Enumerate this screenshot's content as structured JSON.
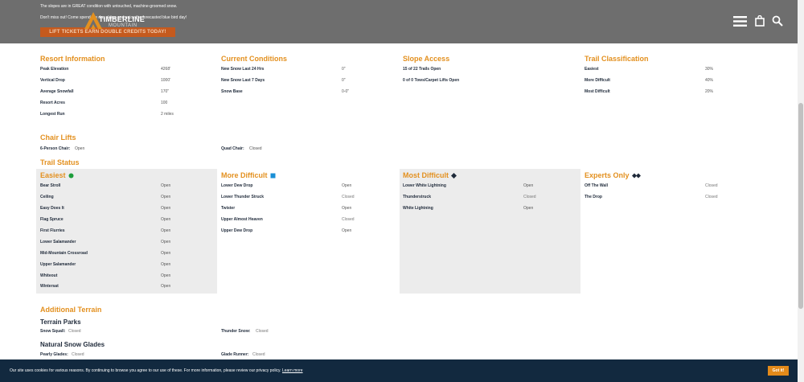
{
  "header": {
    "promo_line1": "The slopes are in GREAT condition with untouched, machine-groomed snow.",
    "promo_line2": "Don't miss out! Come spend the day skiing and enjoy the forecasted blue bird day!",
    "promo_button": "LIFT TICKETS EARN DOUBLE CREDITS TODAY!",
    "logo_name": "TIMBERLINE",
    "logo_sub": "MOUNTAIN",
    "icons": [
      "menu-icon",
      "shopping-bag-icon",
      "search-icon"
    ],
    "background": "#6e6e6e"
  },
  "resort_information": {
    "title": "Resort Information",
    "rows": [
      {
        "label": "Peak Elevation",
        "value": "4268'"
      },
      {
        "label": "Vertical Drop",
        "value": "1000'"
      },
      {
        "label": "Average Snowfall",
        "value": "170\""
      },
      {
        "label": "Resort Acres",
        "value": "100"
      },
      {
        "label": "Longest Run",
        "value": "2 miles"
      }
    ]
  },
  "current_conditions": {
    "title": "Current Conditions",
    "rows": [
      {
        "label": "New Snow Last 24 Hrs",
        "value": "0\""
      },
      {
        "label": "New Snow Last 7 Days",
        "value": "0\""
      },
      {
        "label": "Snow Base",
        "value": "0-0\""
      }
    ]
  },
  "slope_access": {
    "title": "Slope Access",
    "rows": [
      {
        "label": "15 of 22 Trails Open"
      },
      {
        "label": "0 of 0 Tows/Carpet Lifts Open"
      }
    ]
  },
  "trail_classification": {
    "title": "Trail Classification",
    "rows": [
      {
        "label": "Easiest",
        "value": "30%"
      },
      {
        "label": "More Difficult",
        "value": "40%"
      },
      {
        "label": "Most Difficult",
        "value": "20%"
      }
    ]
  },
  "chair_lifts": {
    "title": "Chair Lifts",
    "items": [
      {
        "label": "6-Person Chair:",
        "value": "Open"
      },
      {
        "label": "Quad Chair:",
        "value": "Closed"
      }
    ]
  },
  "trail_status": {
    "title": "Trail Status",
    "columns": [
      {
        "name": "Easiest",
        "icon": "green-circle-icon",
        "icon_color": "#1e9e3c",
        "shaded": true,
        "trails": [
          {
            "name": "Bear Stroll",
            "status": "Open"
          },
          {
            "name": "Ceiling",
            "status": "Open"
          },
          {
            "name": "Easy Does It",
            "status": "Open"
          },
          {
            "name": "Flag Spruce",
            "status": "Open"
          },
          {
            "name": "First Flurries",
            "status": "Open"
          },
          {
            "name": "Lower Salamander",
            "status": "Open"
          },
          {
            "name": "Mid-Mountain Crossroad",
            "status": "Open"
          },
          {
            "name": "Upper Salamander",
            "status": "Open"
          },
          {
            "name": "Whiteout",
            "status": "Open"
          },
          {
            "name": "Wintersat",
            "status": "Open"
          }
        ]
      },
      {
        "name": "More Difficult",
        "icon": "blue-square-icon",
        "icon_color": "#1a8fd6",
        "shaded": false,
        "trails": [
          {
            "name": "Lower Dew Drop",
            "status": "Open"
          },
          {
            "name": "Lower Thunder Struck",
            "status": "Closed"
          },
          {
            "name": "Twister",
            "status": "Open"
          },
          {
            "name": "Upper Almost Heaven",
            "status": "Closed"
          },
          {
            "name": "Upper Dew Drop",
            "status": "Open"
          }
        ]
      },
      {
        "name": "Most Difficult",
        "icon": "black-diamond-icon",
        "icon_color": "#1f2a3a",
        "shaded": true,
        "trails": [
          {
            "name": "Lower White Lightning",
            "status": "Open"
          },
          {
            "name": "Thunderstruck",
            "status": "Closed"
          },
          {
            "name": "White Lightning",
            "status": "Open"
          }
        ]
      },
      {
        "name": "Experts Only",
        "icon": "double-black-diamond-icon",
        "icon_color": "#1f2a3a",
        "shaded": false,
        "trails": [
          {
            "name": "Off The Wall",
            "status": "Closed"
          },
          {
            "name": "The Drop",
            "status": "Closed"
          }
        ]
      }
    ]
  },
  "additional_terrain": {
    "title": "Additional Terrain",
    "terrain_parks": {
      "title": "Terrain Parks",
      "items": [
        {
          "label": "Snow Squall:",
          "value": "Closed"
        },
        {
          "label": "Thunder Snow:",
          "value": "Closed"
        }
      ]
    },
    "natural_snow_glades": {
      "title": "Natural Snow Glades",
      "items": [
        {
          "label": "Pearly Glades:",
          "value": "Closed"
        },
        {
          "label": "Glade Runner:",
          "value": "Closed"
        }
      ]
    }
  },
  "cookie_banner": {
    "text": "Our site uses cookies for various reasons. By continuing to browse you agree to our use of these. For more information, please review our privacy policy.",
    "link": "Learn more",
    "button": "Got it!"
  },
  "colors": {
    "accent": "#e3901f",
    "navy": "#12293f",
    "button_orange": "#e38a1a",
    "panel_gray": "#ececec"
  }
}
